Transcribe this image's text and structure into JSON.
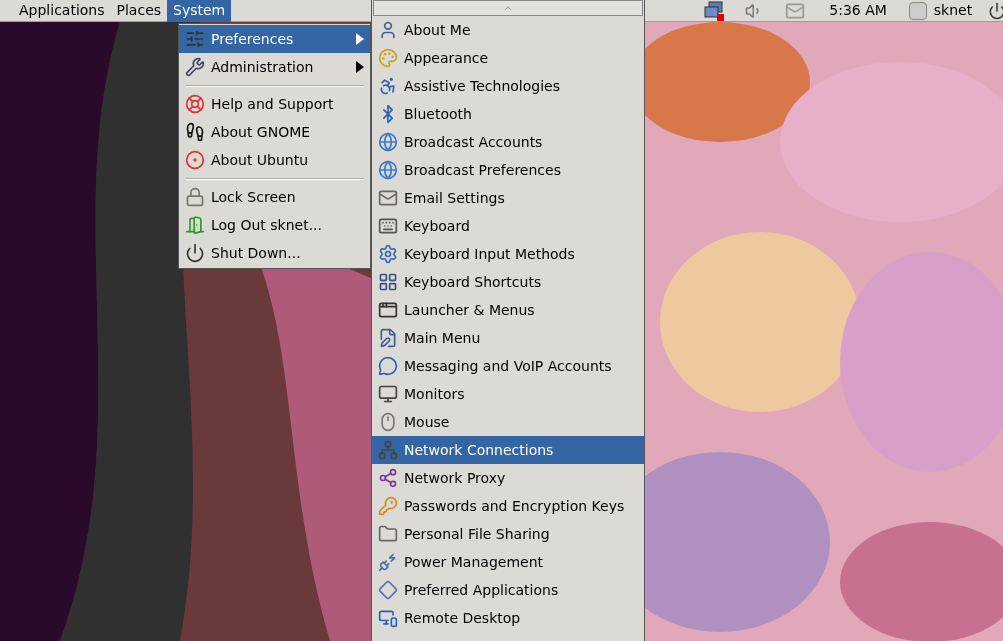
{
  "top_panel": {
    "menus": [
      {
        "label": "Applications",
        "selected": false
      },
      {
        "label": "Places",
        "selected": false
      },
      {
        "label": "System",
        "selected": true
      }
    ],
    "clock": "5:36 AM",
    "user": "sknet"
  },
  "system_menu": {
    "groups": [
      [
        {
          "label": "Preferences",
          "selected": true,
          "submenu": true
        },
        {
          "label": "Administration",
          "selected": false,
          "submenu": true
        }
      ],
      [
        {
          "label": "Help and Support",
          "selected": false,
          "submenu": false
        },
        {
          "label": "About GNOME",
          "selected": false,
          "submenu": false
        },
        {
          "label": "About Ubuntu",
          "selected": false,
          "submenu": false
        }
      ],
      [
        {
          "label": "Lock Screen",
          "selected": false,
          "submenu": false
        },
        {
          "label": "Log Out sknet...",
          "selected": false,
          "submenu": false
        },
        {
          "label": "Shut Down...",
          "selected": false,
          "submenu": false
        }
      ]
    ]
  },
  "preferences_menu": {
    "items": [
      {
        "label": "About Me",
        "selected": false
      },
      {
        "label": "Appearance",
        "selected": false
      },
      {
        "label": "Assistive Technologies",
        "selected": false
      },
      {
        "label": "Bluetooth",
        "selected": false
      },
      {
        "label": "Broadcast Accounts",
        "selected": false
      },
      {
        "label": "Broadcast Preferences",
        "selected": false
      },
      {
        "label": "Email Settings",
        "selected": false
      },
      {
        "label": "Keyboard",
        "selected": false
      },
      {
        "label": "Keyboard Input Methods",
        "selected": false
      },
      {
        "label": "Keyboard Shortcuts",
        "selected": false
      },
      {
        "label": "Launcher & Menus",
        "selected": false
      },
      {
        "label": "Main Menu",
        "selected": false
      },
      {
        "label": "Messaging and VoIP Accounts",
        "selected": false
      },
      {
        "label": "Monitors",
        "selected": false
      },
      {
        "label": "Mouse",
        "selected": false
      },
      {
        "label": "Network Connections",
        "selected": true
      },
      {
        "label": "Network Proxy",
        "selected": false
      },
      {
        "label": "Passwords and Encryption Keys",
        "selected": false
      },
      {
        "label": "Personal File Sharing",
        "selected": false
      },
      {
        "label": "Power Management",
        "selected": false
      },
      {
        "label": "Preferred Applications",
        "selected": false
      },
      {
        "label": "Remote Desktop",
        "selected": false
      }
    ]
  }
}
